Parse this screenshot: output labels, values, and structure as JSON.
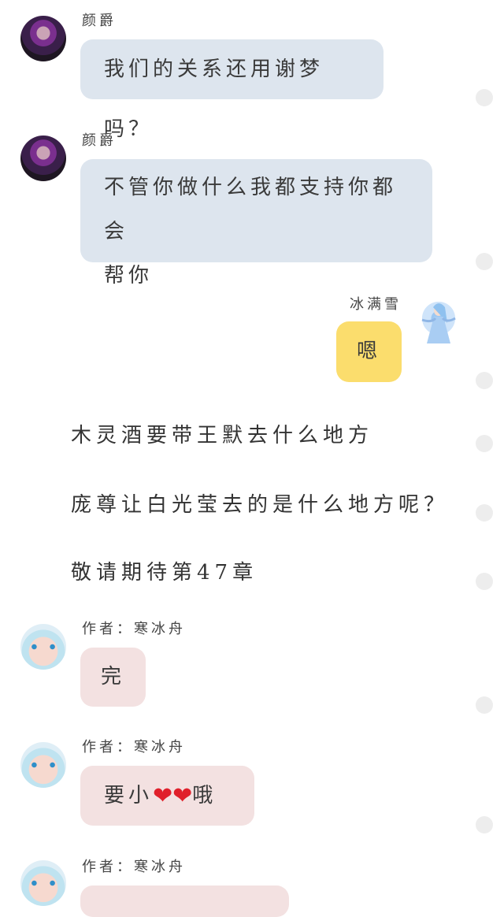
{
  "messages": {
    "m1": {
      "sender": "颜爵",
      "text": "我们的关系还用谢梦吗？"
    },
    "m2": {
      "sender": "颜爵",
      "line1": "不管你做什么我都支持你都会",
      "line2": "帮你"
    },
    "m3": {
      "sender": "冰满雪",
      "text": "嗯"
    },
    "m4": {
      "sender": "作者：寒冰舟",
      "text": "完"
    },
    "m5": {
      "sender": "作者：寒冰舟",
      "text_before": "要小",
      "hearts": "❤❤",
      "text_after": "哦"
    },
    "m6": {
      "sender": "作者：寒冰舟"
    }
  },
  "narration": {
    "line1": "木灵酒要带王默去什么地方",
    "line2": "庞尊让白光莹去的是什么地方呢？",
    "line3": "敬请期待第47章"
  },
  "colors": {
    "bubble_blue": "#dde5ee",
    "bubble_pink": "#f3e1e1",
    "bubble_yellow": "#fbdd6d",
    "heart": "#e0202b"
  },
  "icons": {
    "avatar_dark": "anime-girl-purple-hair-avatar",
    "avatar_fairy": "blue-fairy-avatar",
    "avatar_face": "anime-face-avatar",
    "side_dots": "gray-dot-icon"
  }
}
